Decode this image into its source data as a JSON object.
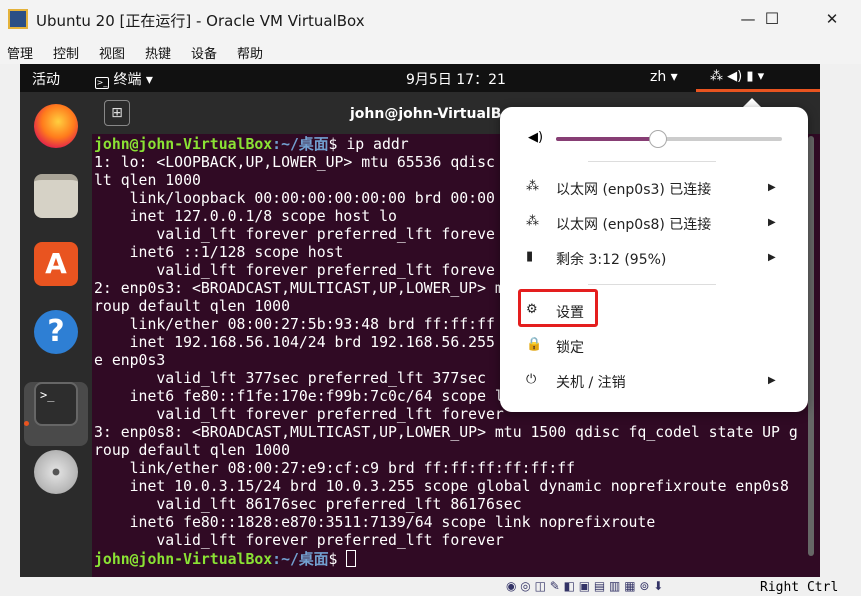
{
  "window": {
    "title": "Ubuntu 20 [正在运行] - Oracle VM VirtualBox",
    "minimize": "—",
    "maximize": "☐",
    "close": "✕"
  },
  "menubar": [
    "管理",
    "控制",
    "视图",
    "热键",
    "设备",
    "帮助"
  ],
  "topbar": {
    "activities": "活动",
    "app_menu": "终端 ▾",
    "clock": "9月5日  17：21",
    "lang": "zh ▾",
    "tray": "⁂  ◀)  ▮  ▾"
  },
  "terminal": {
    "title": "john@john-VirtualBo",
    "newtab": "⊞",
    "prompt_user": "john@john-VirtualBox",
    "prompt_path": ":~/桌面",
    "prompt_end": "$ ",
    "command": "ip addr",
    "lines": [
      "1: lo: <LOOPBACK,UP,LOWER_UP> mtu 65536 qdisc",
      "lt qlen 1000",
      "    link/loopback 00:00:00:00:00:00 brd 00:00",
      "    inet 127.0.0.1/8 scope host lo",
      "       valid_lft forever preferred_lft foreve",
      "    inet6 ::1/128 scope host",
      "       valid_lft forever preferred_lft foreve",
      "2: enp0s3: <BROADCAST,MULTICAST,UP,LOWER_UP> m",
      "roup default qlen 1000",
      "    link/ether 08:00:27:5b:93:48 brd ff:ff:ff",
      "    inet 192.168.56.104/24 brd 192.168.56.255",
      "e enp0s3",
      "       valid_lft 377sec preferred_lft 377sec",
      "    inet6 fe80::f1fe:170e:f99b:7c0c/64 scope l",
      "       valid_lft forever preferred_lft forever",
      "3: enp0s8: <BROADCAST,MULTICAST,UP,LOWER_UP> mtu 1500 qdisc fq_codel state UP g",
      "roup default qlen 1000",
      "    link/ether 08:00:27:e9:cf:c9 brd ff:ff:ff:ff:ff:ff",
      "    inet 10.0.3.15/24 brd 10.0.3.255 scope global dynamic noprefixroute enp0s8",
      "       valid_lft 86176sec preferred_lft 86176sec",
      "    inet6 fe80::1828:e870:3511:7139/64 scope link noprefixroute",
      "       valid_lft forever preferred_lft forever"
    ]
  },
  "menu": {
    "volume_icon": "speaker-icon",
    "volume_level": 0.45,
    "items": [
      {
        "icon": "⁂",
        "label": "以太网 (enp0s3) 已连接",
        "arrow": "▶"
      },
      {
        "icon": "⁂",
        "label": "以太网 (enp0s8) 已连接",
        "arrow": "▶"
      },
      {
        "icon": "▮",
        "label": "剩余 3:12 (95%)",
        "arrow": "▶"
      },
      {
        "icon": "⚙",
        "label": "设置",
        "arrow": ""
      },
      {
        "icon": "🔒",
        "label": "锁定",
        "arrow": ""
      },
      {
        "icon": "⏻",
        "label": "关机 / 注销",
        "arrow": "▶"
      }
    ]
  },
  "statusbar": {
    "host_key": "Right Ctrl"
  },
  "colors": {
    "terminal_bg": "#300a24",
    "prompt_user": "#8ae234",
    "prompt_path": "#729fcf",
    "highlight": "#e41e1e",
    "ubuntu_orange": "#e95420"
  }
}
